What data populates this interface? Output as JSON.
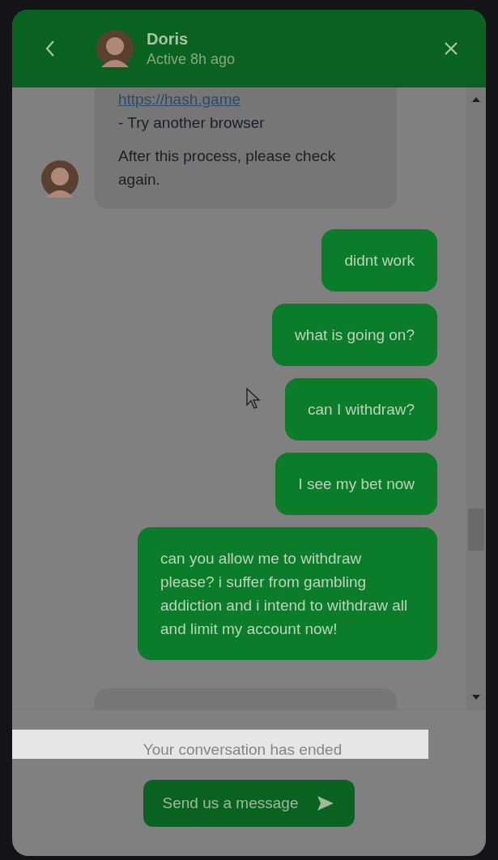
{
  "header": {
    "name": "Doris",
    "status": "Active 8h ago"
  },
  "messages": [
    {
      "kind": "agent",
      "avatar": true,
      "paragraphs": [
        {
          "kind": "link",
          "text": "https://hash.game"
        },
        {
          "kind": "text",
          "text": "- Try another browser"
        },
        {
          "kind": "para",
          "text": "After this process, please check again."
        }
      ]
    },
    {
      "kind": "user",
      "paragraphs": [
        {
          "kind": "text",
          "text": "didnt work"
        }
      ]
    },
    {
      "kind": "user",
      "paragraphs": [
        {
          "kind": "text",
          "text": "what is going on?"
        }
      ]
    },
    {
      "kind": "user",
      "paragraphs": [
        {
          "kind": "text",
          "text": "can I withdraw?"
        }
      ]
    },
    {
      "kind": "user",
      "paragraphs": [
        {
          "kind": "text",
          "text": "I see my bet now"
        }
      ]
    },
    {
      "kind": "user",
      "paragraphs": [
        {
          "kind": "text",
          "text": "can you allow me to withdraw please? i suffer from gambling addiction and i intend to withdraw all and limit my account now!"
        }
      ]
    },
    {
      "kind": "agent",
      "avatar": false
    }
  ],
  "footer": {
    "notice": "Your conversation has ended",
    "button": "Send us a message"
  }
}
